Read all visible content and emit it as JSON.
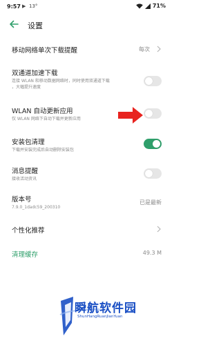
{
  "status_bar": {
    "time": "9:57",
    "indicator_1": "▶",
    "indicator_2": "13°",
    "battery": "71%"
  },
  "header": {
    "title": "设置"
  },
  "rows": {
    "mobile_download": {
      "title": "移动网络单次下载提醒",
      "value": "每次"
    },
    "dual_channel": {
      "title": "双通道加速下载",
      "sub1": "连接 WLAN 和移动数据网络时，同时使用双通道下载",
      "sub2": "，大幅提升速度",
      "enabled": false
    },
    "wlan_auto_update": {
      "title": "WLAN 自动更新应用",
      "sub1": "仅 WLAN 网络下自动下载并更新应用",
      "enabled": false
    },
    "package_clean": {
      "title": "安装包清理",
      "sub1": "下载并安装完成后自动删除安装包",
      "enabled": true
    },
    "notifications": {
      "title": "消息提醒",
      "sub1": "接收活动资讯",
      "enabled": false
    },
    "version": {
      "title": "版本号",
      "sub1": "7.9.0_1dadc59_200310",
      "value": "已是最新"
    },
    "personalized": {
      "title": "个性化推荐"
    },
    "clear_cache": {
      "title": "清理缓存",
      "value": "49.3 M"
    }
  },
  "watermark": {
    "text": "瞬航软件园",
    "url": "ShunHangRuanJianYuan"
  },
  "colors": {
    "accent": "#2f9f6b",
    "arrow": "#e8231f",
    "watermark": "#1a4fc4"
  }
}
